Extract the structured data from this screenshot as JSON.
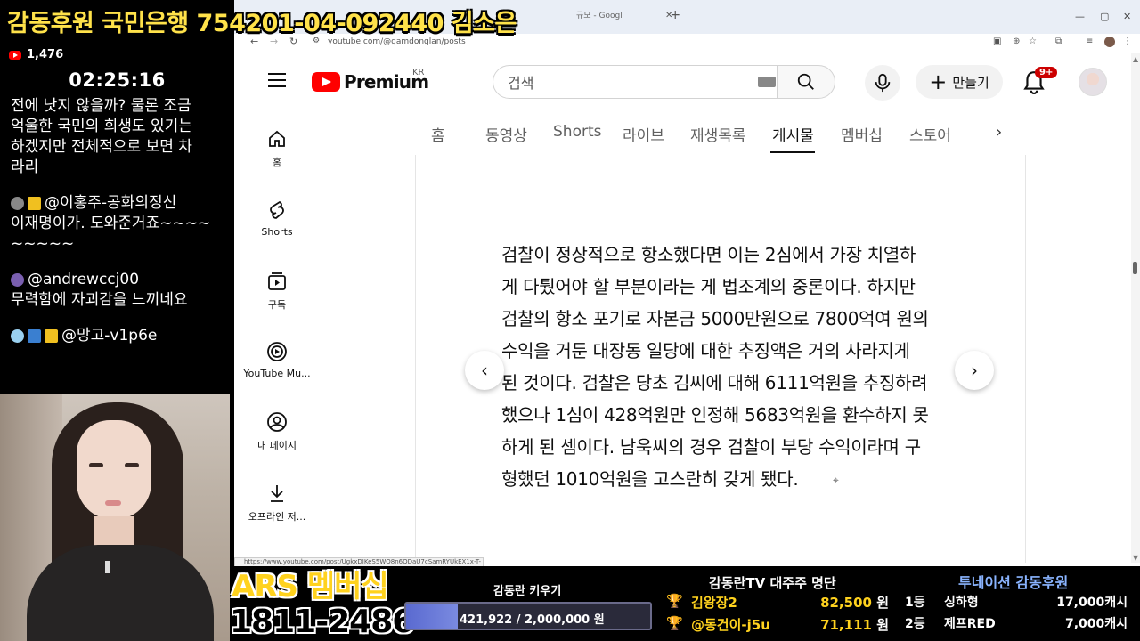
{
  "stream": {
    "donation_banner": "감동후원 국민은행 754201-04-092440 김소은",
    "viewer_count": "1,476",
    "timer": "02:25:16",
    "chat": [
      {
        "name": "",
        "lines": [
          "전에 낫지 않을까? 물론 조금",
          "억울한 국민의 희생도 있기는",
          "하겠지만 전체적으로 보면 차",
          "라리"
        ]
      },
      {
        "name": "@이홍주-공화의정신",
        "lines": [
          "이재명이가. 도와준거죠~~~~",
          "~~~~~"
        ]
      },
      {
        "name": "@andrewccj00",
        "lines": [
          "무력함에 자괴감을 느끼네요"
        ]
      },
      {
        "name": "@망고-v1p6e",
        "lines": []
      }
    ]
  },
  "browser": {
    "tab_title": "규모 - Googl",
    "url": "youtube.com/@gamdonglan/posts",
    "status_url": "https://www.youtube.com/post/UgkxDIKeS5WQ8n6QDaU7cSamRYUkEX1x-T-"
  },
  "youtube": {
    "logo_text": "Premium",
    "logo_region": "KR",
    "search_placeholder": "검색",
    "create_label": "만들기",
    "notif_badge": "9+",
    "sidebar": [
      {
        "label": "홈",
        "icon": "home-icon"
      },
      {
        "label": "Shorts",
        "icon": "shorts-icon"
      },
      {
        "label": "구독",
        "icon": "subscriptions-icon"
      },
      {
        "label": "YouTube Mu...",
        "icon": "youtube-music-icon"
      },
      {
        "label": "내 페이지",
        "icon": "you-icon"
      },
      {
        "label": "오프라인 저...",
        "icon": "download-icon"
      }
    ],
    "channel_tabs": [
      "홈",
      "동영상",
      "Shorts",
      "라이브",
      "재생목록",
      "게시물",
      "멤버십",
      "스토어"
    ],
    "active_tab": "게시물",
    "post_lines": [
      "검찰이 정상적으로 항소했다면 이는 2심에서 가장 치열하",
      "게 다퉜어야 할 부분이라는 게 법조계의 중론이다. 하지만",
      "검찰의 항소 포기로 자본금 5000만원으로 7800억여 원의",
      "수익을 거둔 대장동 일당에 대한 추징액은 거의 사라지게",
      "된 것이다. 검찰은 당초 김씨에 대해 6111억원을 추징하려",
      "했으나 1심이 428억원만 인정해 5683억원을 환수하지 못",
      "하게 된 셈이다. 남욱씨의 경우 검찰이 부당 수익이라며 구",
      "형했던 1010억원을 고스란히 갖게 됐다."
    ]
  },
  "overlay": {
    "ars_label": "ARS 멤버십",
    "ars_number": "1811-2486",
    "goal_title": "감동란 키우기",
    "goal_text": "421,922 / 2,000,000 원",
    "goal_fraction": 0.211,
    "ranking_title": "감동란TV 대주주 명단",
    "ranking": [
      {
        "name": "김왕장2",
        "amount": "82,500",
        "unit": "원"
      },
      {
        "name": "@동건이-j5u",
        "amount": "71,111",
        "unit": "원"
      }
    ],
    "twonation_title": "투네이션 감동후원",
    "twonation": [
      {
        "rank": "1등",
        "name": "싱하형",
        "amount": "17,000캐시"
      },
      {
        "rank": "2등",
        "name": "제프RED",
        "amount": "7,000캐시"
      }
    ]
  }
}
